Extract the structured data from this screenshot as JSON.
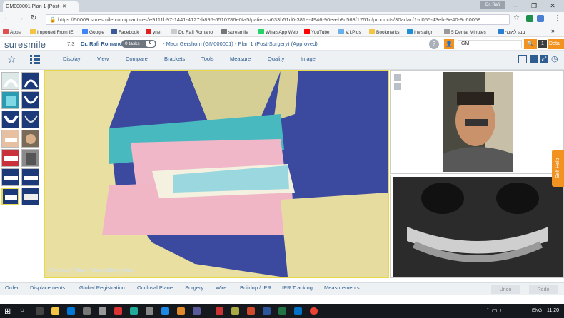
{
  "browser": {
    "tab_title": "GM000001 Plan 1 (Post-",
    "user_badge": "Dr. Rafi",
    "url": "https://50009.suresmile.com/practices/e9111b97-1441-4127-b895-6510786e0fa5/patients/633b51d0-381e-4946-90ea-b8c563f1761c/products/30adacf1-d055-43eb-9e40-9d60058",
    "bookmarks": [
      "Apps",
      "Imported From IE",
      "Google",
      "Facebook",
      "ynet",
      "Dr. Rafi Romano",
      "suresmile",
      "WhatsApp Web",
      "YouTube",
      "V.I.Plus",
      "Bookmarks",
      "Invisalign",
      "5 Dental Minutes",
      "בנק לאומי"
    ],
    "more": "»"
  },
  "app": {
    "logo": "suresmile",
    "version": "7.3",
    "doctor": "Dr. Rafi Romano",
    "tasks_label": "0 tasks",
    "tasks_count": "0",
    "patient": "-  Maor Gershom (GM000001)  -  Plan 1 (Post-Surgery) (Approved)",
    "help": "?",
    "search_value": "GM",
    "result_count": "1",
    "detail_label": "Detai"
  },
  "menu": [
    "Display",
    "View",
    "Compare",
    "Brackets",
    "Tools",
    "Measure",
    "Quality",
    "Image"
  ],
  "viewer": {
    "camera_label": "Camera (Object View) Navigation"
  },
  "side_tab": "Self Help",
  "bottom_menu": [
    "Order",
    "Displacements",
    "Global Registration",
    "Occlusal Plane",
    "Surgery",
    "Wire",
    "Buildup / IPR",
    "IPR Tracking",
    "Measurements"
  ],
  "undo_label": "Undo",
  "redo_label": "Redo",
  "taskbar": {
    "lang": "ENG",
    "time": "11:20"
  },
  "colors": {
    "accent": "#f29221",
    "brand": "#3d5a7a",
    "link": "#2f5d8f",
    "viewport_bg": "#3b4a9e",
    "highlight": "#e8d84a"
  }
}
